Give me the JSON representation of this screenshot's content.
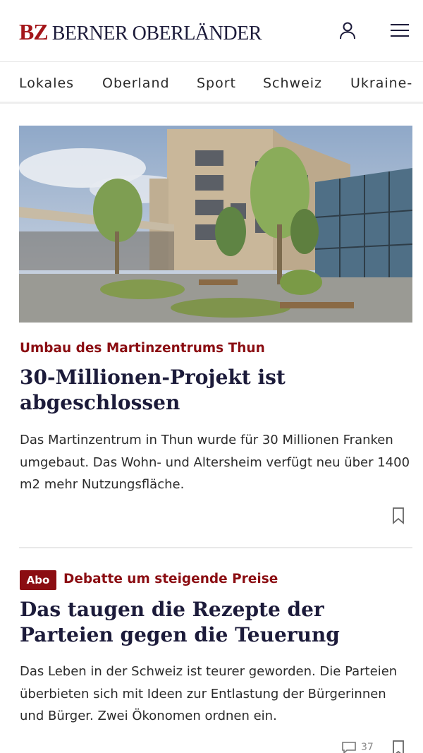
{
  "header": {
    "logo_bz": "BZ",
    "logo_name": "BERNER OBERLÄNDER",
    "user_icon": "user-icon",
    "menu_icon": "hamburger-menu-icon"
  },
  "nav": {
    "items": [
      "Lokales",
      "Oberland",
      "Sport",
      "Schweiz",
      "Ukraine-"
    ]
  },
  "articles": [
    {
      "kicker": "Umbau des Martinzentrums Thun",
      "headline": "30-Millionen-Projekt ist abgeschlossen",
      "lead": "Das Martinzentrum in Thun wurde für 30 Millionen Franken umgebaut. Das Wohn- und Altersheim verfügt neu über 1400 m2 mehr Nutzungsfläche.",
      "bookmark_icon": "bookmark-icon"
    },
    {
      "badge": "Abo",
      "kicker": "Debatte um steigende Preise",
      "headline": "Das taugen die Rezepte der Parteien gegen die Teuerung",
      "lead": "Das Leben in der Schweiz ist teurer geworden. Die Parteien überbieten sich mit Ideen zur Entlastung der Bürgerinnen und Bürger. Zwei Ökonomen ordnen ein.",
      "comment_count": "37",
      "comment_icon": "comment-icon",
      "bookmark_icon": "bookmark-icon"
    }
  ],
  "colors": {
    "brand_red": "#a4161a",
    "kicker_red": "#8b0d12",
    "headline_navy": "#1c1b3a"
  }
}
